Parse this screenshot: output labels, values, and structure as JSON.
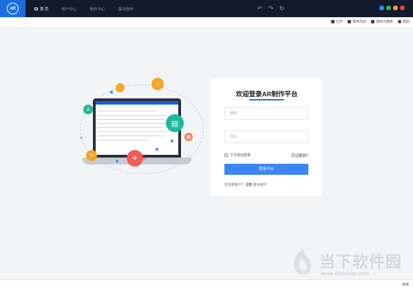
{
  "app": {
    "logo_text": "AR"
  },
  "nav": {
    "items": [
      {
        "label": "首 页"
      },
      {
        "label": "帐户中心"
      },
      {
        "label": "制作中心"
      },
      {
        "label": "蛋日放布"
      }
    ]
  },
  "toolbar": {
    "items": [
      {
        "label": "打开",
        "icon": "folder-icon"
      },
      {
        "label": "保存项目",
        "icon": "save-icon"
      },
      {
        "label": "保存为模板",
        "icon": "template-icon"
      },
      {
        "label": "帮助",
        "icon": "help-icon"
      }
    ]
  },
  "login": {
    "title": "欢迎登录AR制作平台",
    "account_placeholder": "邮箱",
    "password_placeholder": "密码",
    "remember_label": "下次自动登录",
    "forgot_label": "忘记密码?",
    "submit_label": "登录平台",
    "register_prefix": "还没有账户？",
    "register_link": "注册",
    "register_suffix": " 成为用户"
  },
  "watermark": {
    "text": "当下软件园",
    "url": "www.downxia.com"
  },
  "status": {
    "text": "就绪"
  },
  "colors": {
    "titlebar": "#121a2e",
    "brand": "#1a6fe0",
    "button": "#3b86f2",
    "win_controls": [
      "#2f8cf0",
      "#2dbb5a",
      "#f0a030",
      "#e84040"
    ]
  }
}
